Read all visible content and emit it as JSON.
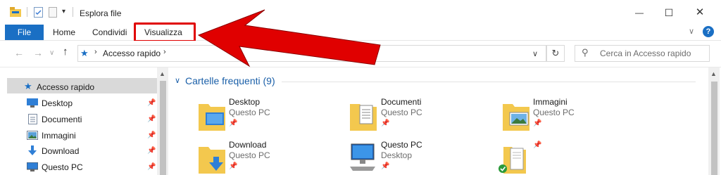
{
  "window": {
    "title": "Esplora file",
    "minimize_glyph": "—",
    "maximize_glyph": "☐",
    "close_glyph": "✕"
  },
  "ribbon": {
    "tabs": [
      {
        "label": "File",
        "active": true
      },
      {
        "label": "Home"
      },
      {
        "label": "Condividi"
      },
      {
        "label": "Visualizza",
        "highlighted": true
      }
    ],
    "help_label": "?"
  },
  "address_bar": {
    "location": "Accesso rapido",
    "search_placeholder": "Cerca in Accesso rapido"
  },
  "sidebar": {
    "items": [
      {
        "label": "Accesso rapido",
        "icon": "star-icon",
        "selected": true
      },
      {
        "label": "Desktop",
        "icon": "desktop-icon",
        "pinned": true
      },
      {
        "label": "Documenti",
        "icon": "documents-icon",
        "pinned": true
      },
      {
        "label": "Immagini",
        "icon": "pictures-icon",
        "pinned": true
      },
      {
        "label": "Download",
        "icon": "download-icon",
        "pinned": true
      },
      {
        "label": "Questo PC",
        "icon": "computer-icon",
        "pinned": true
      }
    ]
  },
  "main": {
    "section_title": "Cartelle frequenti (9)",
    "folders": [
      {
        "name": "Desktop",
        "location": "Questo PC",
        "icon": "desktop-folder-icon"
      },
      {
        "name": "Documenti",
        "location": "Questo PC",
        "icon": "documents-folder-icon"
      },
      {
        "name": "Immagini",
        "location": "Questo PC",
        "icon": "pictures-folder-icon"
      },
      {
        "name": "Download",
        "location": "Questo PC",
        "icon": "download-folder-icon"
      },
      {
        "name": "Questo PC",
        "location": "Desktop",
        "icon": "computer-icon"
      },
      {
        "name": "",
        "location": "",
        "icon": "synced-folder-icon"
      }
    ]
  },
  "colors": {
    "accent": "#1a6fc4",
    "highlight_red": "#e00000",
    "folder_yellow": "#f3c84e"
  }
}
